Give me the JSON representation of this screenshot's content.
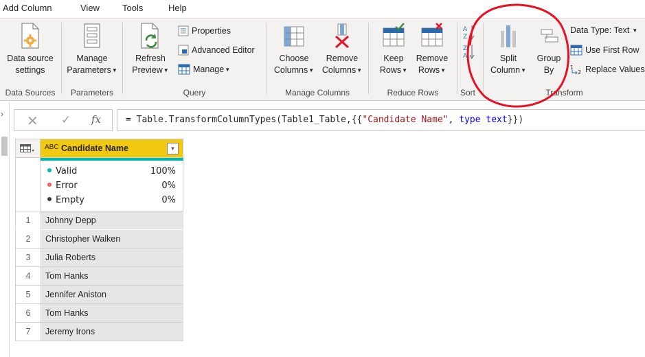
{
  "menu": {
    "items": [
      "Add Column",
      "View",
      "Tools",
      "Help"
    ]
  },
  "ribbon": {
    "data_sources": {
      "title": "Data Sources",
      "settings_line1": "Data source",
      "settings_line2": "settings"
    },
    "parameters": {
      "title": "Parameters",
      "manage_line1": "Manage",
      "manage_line2": "Parameters"
    },
    "query": {
      "title": "Query",
      "refresh_line1": "Refresh",
      "refresh_line2": "Preview",
      "properties": "Properties",
      "advanced_editor": "Advanced Editor",
      "manage": "Manage"
    },
    "manage_columns": {
      "title": "Manage Columns",
      "choose_line1": "Choose",
      "choose_line2": "Columns",
      "remove_line1": "Remove",
      "remove_line2": "Columns"
    },
    "reduce_rows": {
      "title": "Reduce Rows",
      "keep_line1": "Keep",
      "keep_line2": "Rows",
      "remove_line1": "Remove",
      "remove_line2": "Rows"
    },
    "sort": {
      "title": "Sort"
    },
    "transform": {
      "title": "Transform",
      "split_line1": "Split",
      "split_line2": "Column",
      "group_line1": "Group",
      "group_line2": "By",
      "data_type": "Data Type: Text",
      "use_first_row": "Use First Row",
      "replace_values": "Replace Values"
    }
  },
  "formula_bar": {
    "fx": "fx",
    "prefix": "= Table.TransformColumnTypes(Table1_Table,{{",
    "string": "\"Candidate Name\"",
    "mid": ", ",
    "keyword": "type text",
    "suffix": "}})"
  },
  "table": {
    "column_type": "ABC",
    "column_name": "Candidate Name",
    "quality": [
      {
        "label": "Valid",
        "value": "100%",
        "color": "#01b8aa"
      },
      {
        "label": "Error",
        "value": "0%",
        "color": "#fd625e"
      },
      {
        "label": "Empty",
        "value": "0%",
        "color": "#3d3d3d"
      }
    ],
    "rows": [
      {
        "n": "1",
        "value": "Johnny Depp"
      },
      {
        "n": "2",
        "value": "Christopher Walken"
      },
      {
        "n": "3",
        "value": "Julia Roberts"
      },
      {
        "n": "4",
        "value": "Tom Hanks"
      },
      {
        "n": "5",
        "value": "Jennifer Aniston"
      },
      {
        "n": "6",
        "value": "Tom Hanks"
      },
      {
        "n": "7",
        "value": "Jeremy Irons"
      }
    ]
  },
  "colors": {
    "header_accent": "#f2c811",
    "quality_bar": "#01b8aa",
    "annotation": "#e81123"
  }
}
